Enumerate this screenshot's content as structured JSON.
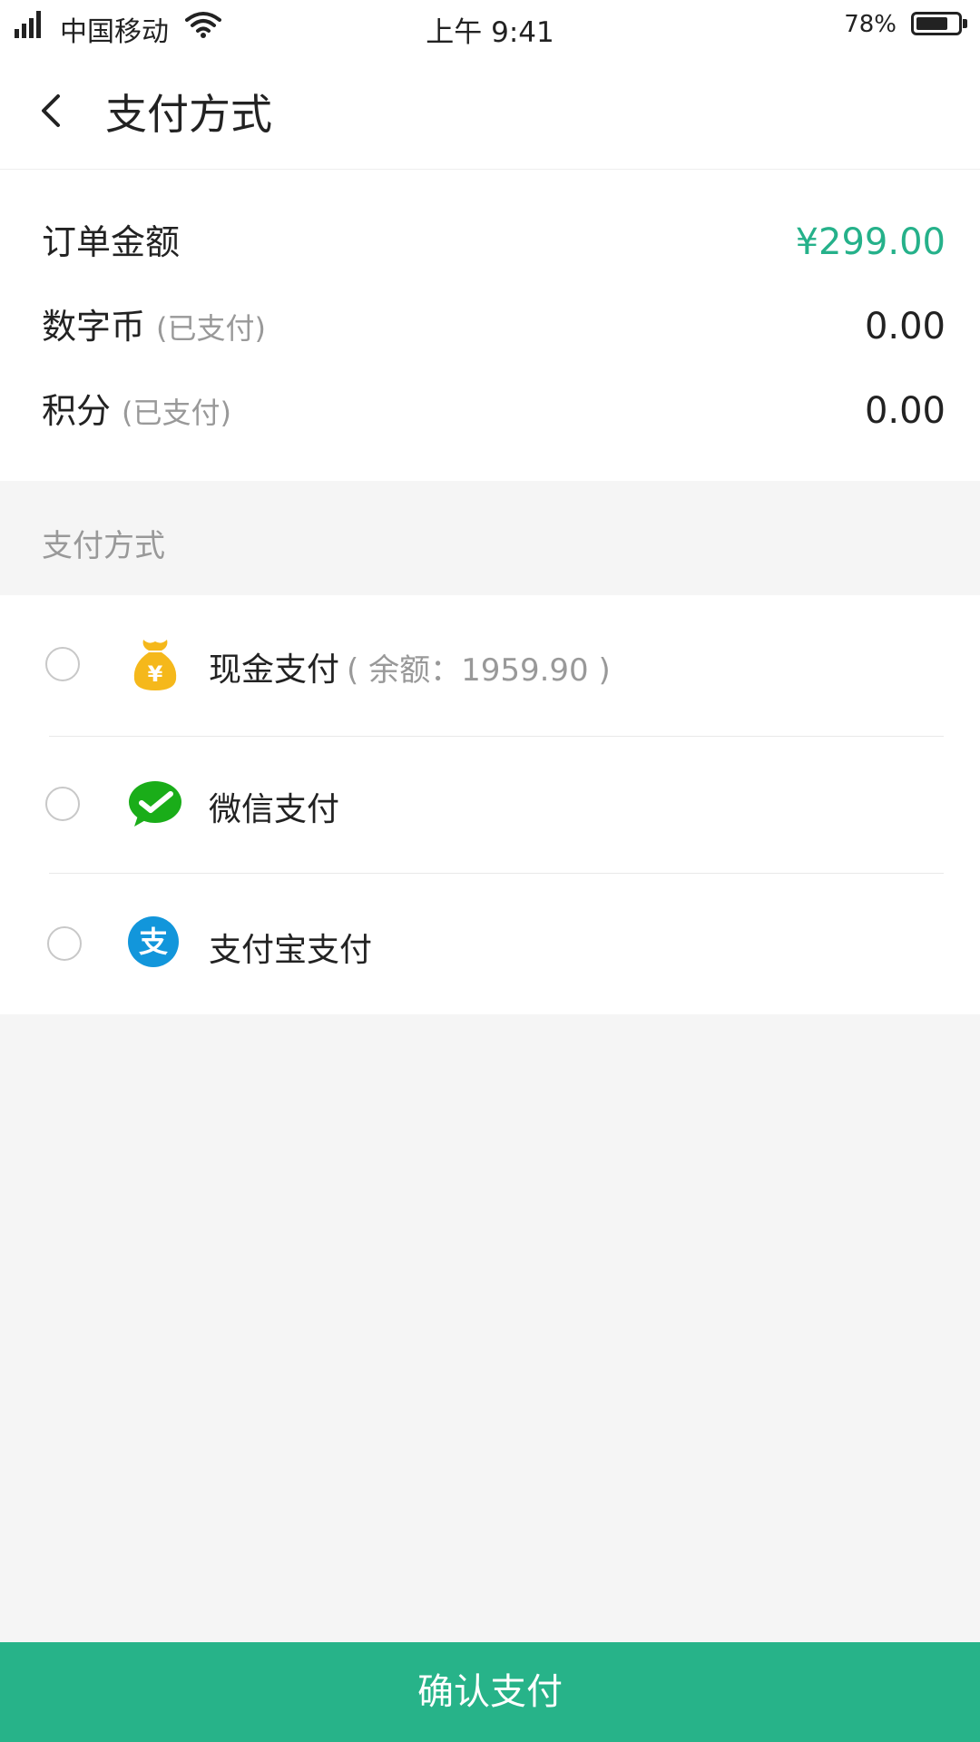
{
  "status_bar": {
    "carrier": "中国移动",
    "time": "上午 9:41",
    "battery_percent": "78%",
    "battery_level": 0.78
  },
  "nav": {
    "title": "支付方式",
    "back_icon": "chevron-left-icon"
  },
  "order": {
    "rows": [
      {
        "label": "订单金额",
        "note": "",
        "value": "¥299.00"
      },
      {
        "label": "数字币",
        "note": "(已支付)",
        "value": "0.00"
      },
      {
        "label": "积分",
        "note": "(已支付)",
        "value": "0.00"
      }
    ]
  },
  "payment_section": {
    "title": "支付方式",
    "methods": [
      {
        "label": "现金支付",
        "balance": "( 余额：1959.90 )",
        "icon": "money-bag-icon",
        "selected": false
      },
      {
        "label": "微信支付",
        "balance": "",
        "icon": "wechat-icon",
        "selected": false
      },
      {
        "label": "支付宝支付",
        "balance": "",
        "icon": "alipay-icon",
        "selected": false
      }
    ]
  },
  "confirm_button": {
    "label": "确认支付"
  },
  "colors": {
    "accent": "#27b389",
    "cash_icon": "#f5b81b",
    "wechat": "#1aad19",
    "alipay": "#1296db"
  }
}
